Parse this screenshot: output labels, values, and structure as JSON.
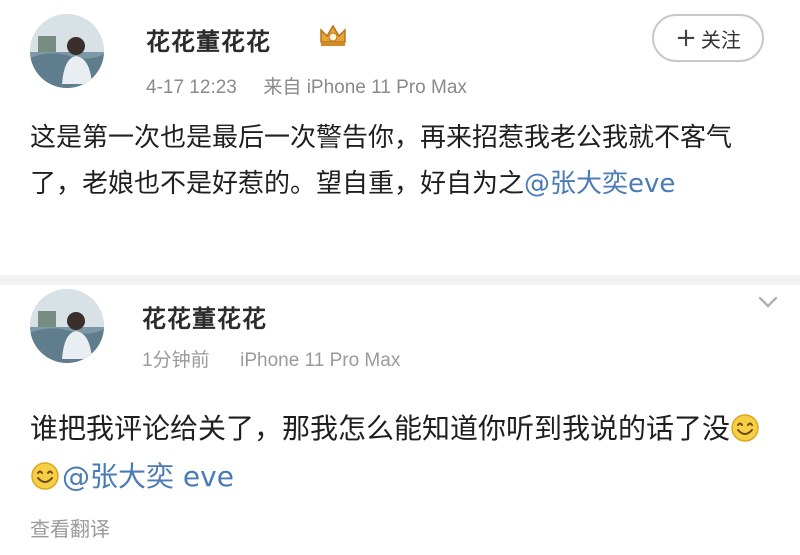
{
  "post": {
    "author": "花花董花花",
    "time": "4-17 12:23",
    "source": "来自 iPhone 11 Pro Max",
    "follow_label": "关注",
    "body_text": "这是第一次也是最后一次警告你，再来招惹我老公我就不客气了，老娘也不是好惹的。望自重，好自为之",
    "mention": "@张大奕eve"
  },
  "comment": {
    "author": "花花董花花",
    "time": "1分钟前",
    "source": "iPhone 11 Pro Max",
    "body_text": "谁把我评论给关了，那我怎么能知道你听到我说的话了没",
    "mention": "@张大奕 eve",
    "translate_label": "查看翻译"
  },
  "colors": {
    "mention": "#4a7bb7",
    "meta": "#8a8a8a",
    "crown": "#e8a33a"
  },
  "icons": {
    "follow": "plus-icon",
    "badge": "crown-icon",
    "menu": "chevron-down-icon",
    "emoji": "smile-icon"
  }
}
